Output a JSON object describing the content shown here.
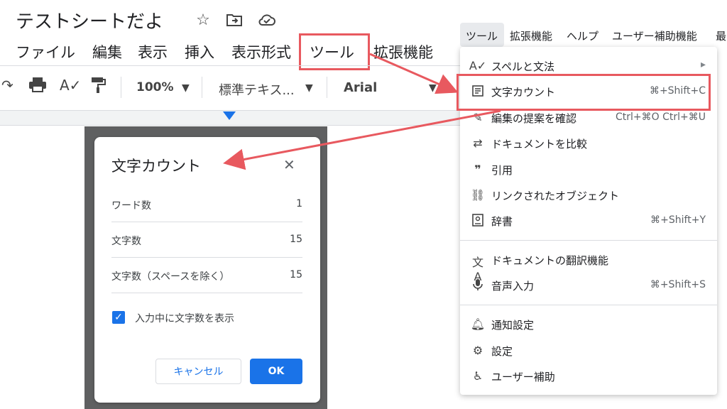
{
  "doc": {
    "title": "テストシートだよ",
    "icons": [
      "star-icon",
      "move-to-folder-icon",
      "cloud-saved-icon"
    ]
  },
  "menubar": {
    "items": [
      "ファイル",
      "編集",
      "表示",
      "挿入",
      "表示形式",
      "ツール",
      "拡張機能"
    ]
  },
  "toolbar": {
    "zoom": "100%",
    "style": "標準テキス...",
    "font": "Arial"
  },
  "dialog": {
    "title": "文字カウント",
    "stats": [
      {
        "label": "ワード数",
        "value": "1"
      },
      {
        "label": "文字数",
        "value": "15"
      },
      {
        "label": "文字数（スペースを除く）",
        "value": "15"
      }
    ],
    "checkbox_label": "入力中に文字数を表示",
    "checkbox_checked": true,
    "cancel_label": "キャンセル",
    "ok_label": "OK"
  },
  "right_menubar": {
    "items": [
      "ツール",
      "拡張機能",
      "ヘルプ",
      "ユーザー補助機能",
      "最"
    ]
  },
  "tools_menu": {
    "items": [
      {
        "label": "スペルと文法",
        "shortcut": "▸",
        "icon": "spellcheck-icon"
      },
      {
        "label": "文字カウント",
        "shortcut": "⌘+Shift+C",
        "icon": "word-count-icon"
      },
      {
        "label": "編集の提案を確認",
        "shortcut": "Ctrl+⌘O Ctrl+⌘U",
        "icon": "review-edits-icon"
      },
      {
        "label": "ドキュメントを比較",
        "shortcut": "",
        "icon": "compare-icon"
      },
      {
        "label": "引用",
        "shortcut": "",
        "icon": "citation-icon"
      },
      {
        "label": "リンクされたオブジェクト",
        "shortcut": "",
        "icon": "linked-objects-icon"
      },
      {
        "label": "辞書",
        "shortcut": "⌘+Shift+Y",
        "icon": "dictionary-icon"
      },
      {
        "label": "ドキュメントの翻訳機能",
        "shortcut": "",
        "icon": "translate-icon"
      },
      {
        "label": "音声入力",
        "shortcut": "⌘+Shift+S",
        "icon": "microphone-icon"
      },
      {
        "label": "通知設定",
        "shortcut": "",
        "icon": "bell-icon"
      },
      {
        "label": "設定",
        "shortcut": "",
        "icon": "settings-icon"
      },
      {
        "label": "ユーザー補助",
        "shortcut": "",
        "icon": "accessibility-icon"
      }
    ]
  },
  "colors": {
    "highlight": "#e8595f",
    "accent": "#1a73e8"
  }
}
